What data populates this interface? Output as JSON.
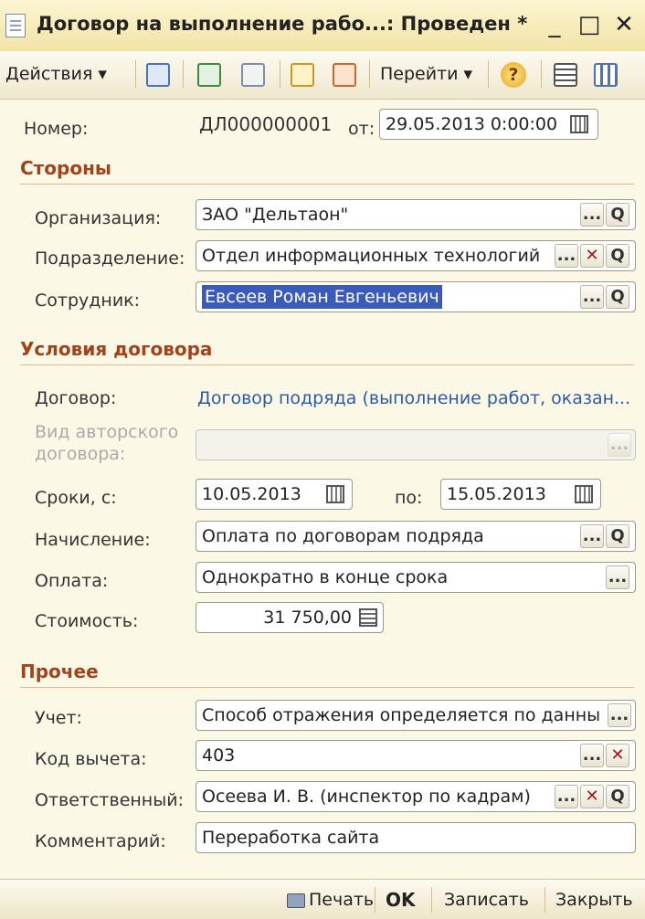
{
  "window": {
    "title": "Договор на выполнение рабо...: Проведен *",
    "minimize": "_",
    "maximize": "□",
    "close": "✕"
  },
  "toolbar": {
    "actions_label": "Действия ▾",
    "goto_label": "Перейти ▾",
    "help": "?"
  },
  "form": {
    "number_label": "Номер:",
    "number_value": "ДЛ000000001",
    "date_label": "от:",
    "date_value": "29.05.2013  0:00:00",
    "sides_header": "Стороны",
    "org_label": "Организация:",
    "org_value": "ЗАО \"Дельтаон\"",
    "dept_label": "Подразделение:",
    "dept_value": "Отдел информационных технологий",
    "employee_label": "Сотрудник:",
    "employee_value": "Евсеев Роман Евгеньевич",
    "terms_header": "Условия договора",
    "contract_label": "Договор:",
    "contract_link": "Договор подряда (выполнение работ, оказан...",
    "author_contract_label_1": "Вид авторского",
    "author_contract_label_2": "договора:",
    "period_label": "Сроки, с:",
    "period_from": "10.05.2013",
    "period_to_label": "по:",
    "period_to": "15.05.2013",
    "accrual_label": "Начисление:",
    "accrual_value": "Оплата по договорам подряда",
    "payment_label": "Оплата:",
    "payment_value": "Однократно в конце срока",
    "cost_label": "Стоимость:",
    "cost_value": "31 750,00",
    "other_header": "Прочее",
    "accounting_label": "Учет:",
    "accounting_value": "Способ отражения определяется по данны",
    "deduction_label": "Код вычета:",
    "deduction_value": "403",
    "responsible_label": "Ответственный:",
    "responsible_value": "Осеева И. В. (инспектор по кадрам)",
    "comment_label": "Комментарий:",
    "comment_value": "Переработка сайта",
    "ellipsis": "...",
    "clear": "✕",
    "search": "Q"
  },
  "footer": {
    "print_label": "Печать",
    "ok_label": "OK",
    "save_label": "Записать",
    "close_label": "Закрыть"
  },
  "colors": {
    "section_header": "#a0441e",
    "selection": "#3a5bb8",
    "link": "#2d5aa8"
  }
}
